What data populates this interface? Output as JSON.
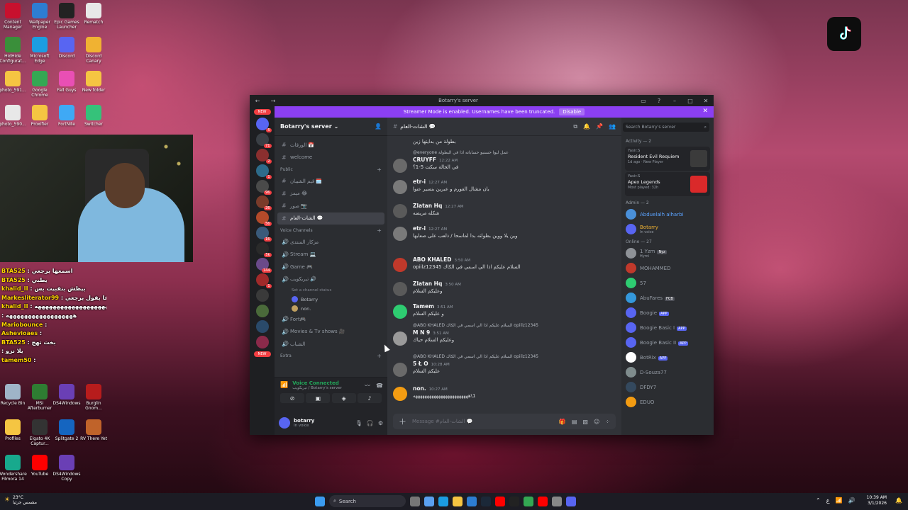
{
  "desktop": {
    "icons": [
      {
        "label": "Content Manager",
        "icon": "content-manager-icon",
        "color": "#c8102e"
      },
      {
        "label": "Wallpaper Engine",
        "icon": "wallpaper-engine-icon",
        "color": "#2d7dd2"
      },
      {
        "label": "Epic Games Launcher",
        "icon": "epic-games-icon",
        "color": "#222222"
      },
      {
        "label": "Rematch",
        "icon": "file-icon",
        "color": "#e8e8e8"
      },
      {
        "label": "HidHide Configurat...",
        "icon": "hidhide-icon",
        "color": "#3a8f3a"
      },
      {
        "label": "Microsoft Edge",
        "icon": "edge-icon",
        "color": "#1b9de2"
      },
      {
        "label": "Discord",
        "icon": "discord-icon",
        "color": "#5865f2"
      },
      {
        "label": "Discord Canary",
        "icon": "discord-canary-icon",
        "color": "#f0b232"
      },
      {
        "label": "photo_591...",
        "icon": "folder-icon",
        "color": "#f5c542"
      },
      {
        "label": "Google Chrome",
        "icon": "chrome-icon",
        "color": "#34a853"
      },
      {
        "label": "Fall Guys",
        "icon": "fall-guys-icon",
        "color": "#e94fb4"
      },
      {
        "label": "New folder",
        "icon": "folder-icon",
        "color": "#f5c542"
      },
      {
        "label": "photo_590...",
        "icon": "file-icon",
        "color": "#e8e8e8"
      },
      {
        "label": "Proxifier",
        "icon": "folder-icon",
        "color": "#f5c542"
      },
      {
        "label": "FortNite",
        "icon": "fortnite-icon",
        "color": "#3fa9f5"
      },
      {
        "label": "Switcher",
        "icon": "switcher-icon",
        "color": "#35c27a"
      }
    ],
    "bottom_icons": [
      {
        "label": "Recycle Bin",
        "icon": "recycle-bin-icon",
        "color": "#9fb4c8"
      },
      {
        "label": "MSI Afterburner",
        "icon": "afterburner-icon",
        "color": "#2e7d32"
      },
      {
        "label": "DS4Windows",
        "icon": "ds4windows-icon",
        "color": "#6a3fb5"
      },
      {
        "label": "Burglin Gnom...",
        "icon": "burglin-gnomes-icon",
        "color": "#b71c1c"
      },
      {
        "label": "Profiles",
        "icon": "folder-icon",
        "color": "#f5c542"
      },
      {
        "label": "Elgato 4K Captur...",
        "icon": "elgato-icon",
        "color": "#333333"
      },
      {
        "label": "Splitgate 2",
        "icon": "splitgate-icon",
        "color": "#1565c0"
      },
      {
        "label": "RV There Yet",
        "icon": "rv-there-yet-icon",
        "color": "#c0632a"
      },
      {
        "label": "Wondershare Filmora 14",
        "icon": "filmora-icon",
        "color": "#18a98d"
      },
      {
        "label": "YouTube",
        "icon": "youtube-icon",
        "color": "#ff0000"
      },
      {
        "label": "DS4Windows Copy",
        "icon": "ds4windows-icon",
        "color": "#6a3fb5"
      }
    ]
  },
  "chat_overlay": [
    {
      "user": "BTA525",
      "msg": "اسمعها برجعي"
    },
    {
      "user": "BTA525",
      "msg": "يطبي"
    },
    {
      "user": "khalid_II",
      "msg": "بيظش بنقبيت بس"
    },
    {
      "user": "Markesliterator99",
      "msg": "بقا بقول برجعي"
    },
    {
      "user": "khalid_II",
      "msg": "ههههههههههههههههههههه"
    },
    {
      "user": "",
      "msg": "ههههههههههههههههههه"
    },
    {
      "user": "Mariobounce",
      "msg": ""
    },
    {
      "user": "Ashevioaes",
      "msg": ""
    },
    {
      "user": "BTA525",
      "msg": "بخت تهج"
    },
    {
      "user": "",
      "msg": "يلا نزو"
    },
    {
      "user": "tamem50",
      "msg": ""
    }
  ],
  "discord": {
    "title": "Botarry's server",
    "banner": {
      "text": "Streamer Mode is enabled. Usernames have been truncated.",
      "button": "Disable"
    },
    "new_badge": "NEW",
    "guild_badges": [
      "5",
      "71",
      "2",
      "1",
      "96",
      "26",
      "56",
      "16",
      "5k",
      "144",
      "1"
    ],
    "server_name": "Botarry's server",
    "channels_top": [
      {
        "icon": "#",
        "name": "الورقات 📅"
      },
      {
        "icon": "#",
        "name": "welcome"
      }
    ],
    "category_public": "Public",
    "channels_public": [
      {
        "icon": "#",
        "name": "قيم الشيبان 🗓️"
      },
      {
        "icon": "#",
        "name": "ميمز 😂"
      },
      {
        "icon": "#",
        "name": "صور 📷"
      },
      {
        "icon": "#",
        "name": "الشات-العام 💬",
        "active": true
      }
    ],
    "category_voice": "Voice Channels",
    "voice_channels": [
      {
        "name": "مزكار المنتدى"
      },
      {
        "name": "Stream 💻"
      },
      {
        "name": "Game 🎮"
      },
      {
        "name": "تبريكويب 🔊",
        "status": "Set a channel status",
        "timer": "13:45:53"
      }
    ],
    "voice_users": [
      "Botarry",
      "non."
    ],
    "voice_channels_2": [
      {
        "name": "Fort🎮"
      },
      {
        "name": "Movies & Tv shows 🎥"
      },
      {
        "name": "الشباب"
      }
    ],
    "category_extra": "Extra",
    "voice_panel": {
      "status": "Voice Connected",
      "sub": "تبريكويب / Botarry's server"
    },
    "user": {
      "name": "botarry",
      "status": "In voice"
    },
    "header": {
      "channel": "الشات-العام 💬"
    },
    "messages": [
      {
        "reply": "",
        "name": "",
        "time": "",
        "text": "بطولة من بدايتها زين"
      },
      {
        "reply": "@everyone عمل ليوا حسنبو حساباته اذا في البطولة",
        "name": "CRUYFF",
        "time": "12:22 AM",
        "text": "في الحالة سكت 5-1؟"
      },
      {
        "reply": "",
        "name": "etr-i",
        "time": "12:27 AM",
        "text": "يان مشال الفورم و عبرين بنسير عنوا"
      },
      {
        "reply": "",
        "name": "Zlatan Hq",
        "time": "12:27 AM",
        "text": "شكله مريضه"
      },
      {
        "reply": "",
        "name": "etr-i",
        "time": "12:27 AM",
        "text": "وين يلا ووين بطولته بدا لماسحا / ذلعب على صعابها"
      },
      {
        "reply": "",
        "name": "ABO KHALED",
        "time": "3:50 AM",
        "text": "السلام عليكم اذا الي اسمي في الكاك opiilz12345"
      },
      {
        "reply": "",
        "name": "Zlatan Hq",
        "time": "3:50 AM",
        "text": "وعليكم السلام"
      },
      {
        "reply": "",
        "name": "Tamem",
        "time": "3:51 AM",
        "text": "و عليكم السلام"
      },
      {
        "reply": "@ABO KHALED السلام عليكم اذا الي اسمي في الكاك opiilz12345",
        "name": "M N 9",
        "time": "3:51 AM",
        "text": "وعليكم السلام حياك"
      },
      {
        "reply": "@ABO KHALED السلام عليكم اذا الي اسمي في الكاك opiilz12345",
        "name": "5 Ł O",
        "time": "10:28 AM",
        "text": "عليكم السلام"
      },
      {
        "reply": "",
        "name": "non.",
        "time": "10:27 AM",
        "text": "1\\ههههههههههههههههههههههههه"
      }
    ],
    "composer_placeholder": "Message #الشات-العام 💬",
    "search_placeholder": "Search Botarry's server",
    "activity_title": "Activity — 2",
    "activities": [
      {
        "who": "Yasir.S",
        "game": "Resident Evil Requiem",
        "meta": "1d ago · New Player",
        "thumb": "#3b3b3b"
      },
      {
        "who": "Yasir.S",
        "game": "Apex Legends",
        "meta": "Most played: 32h",
        "thumb": "#da292a"
      }
    ],
    "admin_title": "Admin — 2",
    "admins": [
      {
        "name": "Abduelalh alharbi",
        "color": "#5ba3ff",
        "av": "#4a90d9"
      },
      {
        "name": "Botarry",
        "sub": "In voice",
        "color": "#f0b232",
        "av": "#5865f2"
      }
    ],
    "online_title": "Online — 27",
    "online": [
      {
        "name": "1 Yzm",
        "tag": "Nyz",
        "sub": "Hymi",
        "av": "#8e9297"
      },
      {
        "name": "MOHAMMED",
        "av": "#c0392b"
      },
      {
        "name": "57",
        "av": "#2ecc71"
      },
      {
        "name": "AbuFares",
        "tag": "FCB",
        "av": "#3498db"
      },
      {
        "name": "Boogie",
        "app": "APP",
        "av": "#5865f2"
      },
      {
        "name": "Boogie Basic I",
        "app": "APP",
        "av": "#5865f2"
      },
      {
        "name": "Boogie Basic II",
        "app": "APP",
        "av": "#5865f2"
      },
      {
        "name": "BotRix",
        "app": "APP",
        "av": "#ffffff"
      },
      {
        "name": "D-Souza77",
        "av": "#7f8c8d"
      },
      {
        "name": "DFDY7",
        "av": "#34495e"
      },
      {
        "name": "EDUO",
        "av": "#f39c12"
      }
    ]
  },
  "taskbar": {
    "weather_temp": "23°C",
    "weather_desc": "مشمس جزئيا",
    "search": "Search",
    "time": "10:39 AM",
    "date": "3/1/2026"
  }
}
